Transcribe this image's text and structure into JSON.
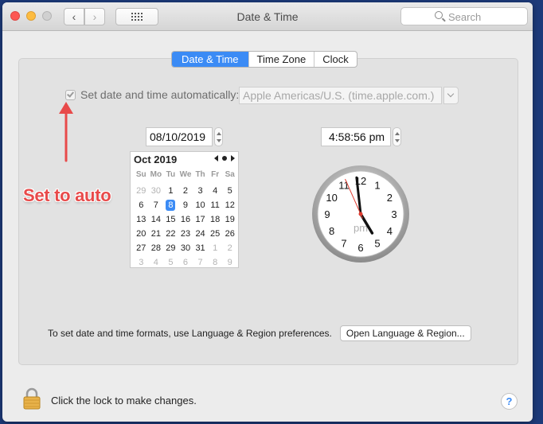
{
  "window": {
    "title": "Date & Time",
    "search_placeholder": "Search"
  },
  "tabs": [
    {
      "label": "Date & Time",
      "active": true
    },
    {
      "label": "Time Zone",
      "active": false
    },
    {
      "label": "Clock",
      "active": false
    }
  ],
  "auto": {
    "label": "Set date and time automatically:",
    "checked": true,
    "server": "Apple Americas/U.S. (time.apple.com.)"
  },
  "date_value": "08/10/2019",
  "time_value": "4:58:56 pm",
  "calendar": {
    "month_label": "Oct 2019",
    "weekdays": [
      "Su",
      "Mo",
      "Tu",
      "We",
      "Th",
      "Fr",
      "Sa"
    ],
    "weeks": [
      [
        "29",
        "30",
        "1",
        "2",
        "3",
        "4",
        "5"
      ],
      [
        "6",
        "7",
        "8",
        "9",
        "10",
        "11",
        "12"
      ],
      [
        "13",
        "14",
        "15",
        "16",
        "17",
        "18",
        "19"
      ],
      [
        "20",
        "21",
        "22",
        "23",
        "24",
        "25",
        "26"
      ],
      [
        "27",
        "28",
        "29",
        "30",
        "31",
        "1",
        "2"
      ],
      [
        "3",
        "4",
        "5",
        "6",
        "7",
        "8",
        "9"
      ]
    ],
    "selected_day": "8"
  },
  "clock": {
    "numerals": [
      "12",
      "1",
      "2",
      "3",
      "4",
      "5",
      "6",
      "7",
      "8",
      "9",
      "10",
      "11"
    ],
    "period": "pm",
    "hour": 4,
    "minute": 58,
    "second": 56
  },
  "annotation": {
    "text": "Set to auto",
    "color": "#e84a4a"
  },
  "formats": {
    "text": "To set date and time formats, use Language & Region preferences.",
    "button": "Open Language & Region..."
  },
  "lock": {
    "text": "Click the lock to make changes."
  },
  "help_label": "?",
  "colors": {
    "accent": "#3b8bf5",
    "close": "#fc5753",
    "minimize": "#fdbc40"
  }
}
